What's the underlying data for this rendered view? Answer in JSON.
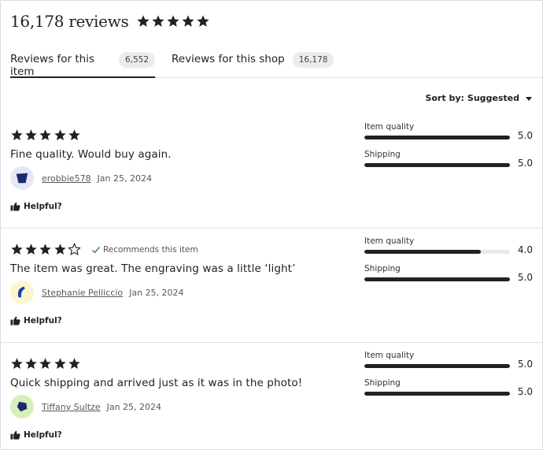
{
  "header": {
    "title": "16,178 reviews",
    "rating": 5
  },
  "tabs": [
    {
      "label": "Reviews for this item",
      "count": "6,552",
      "active": true
    },
    {
      "label": "Reviews for this shop",
      "count": "16,178",
      "active": false
    }
  ],
  "sort": {
    "label": "Sort by:",
    "value": "Suggested"
  },
  "colors": {
    "star": "#222222",
    "check": "#2e8a3a",
    "bar_fill": "#222222",
    "bar_track": "#e9e9e9"
  },
  "reviews": [
    {
      "stars": 5,
      "recommends": "",
      "text": "Fine quality. Would buy again.",
      "reviewer": "erobbie578",
      "date": "Jan 25, 2024",
      "avatar_bg": "#e6e6f5",
      "avatar_color": "#1a2a6c",
      "helpful_label": "Helpful?",
      "ratings": [
        {
          "label": "Item quality",
          "value": "5.0",
          "level": 1.0
        },
        {
          "label": "Shipping",
          "value": "5.0",
          "level": 1.0
        }
      ]
    },
    {
      "stars": 4,
      "recommends": "Recommends this item",
      "text": "The item was great. The engraving was a little ‘light’",
      "reviewer": "Stephanie Pelliccio",
      "date": "Jan 25, 2024",
      "avatar_bg": "#fbf6cf",
      "avatar_color": "#1c3fa8",
      "helpful_label": "Helpful?",
      "ratings": [
        {
          "label": "Item quality",
          "value": "4.0",
          "level": 0.8
        },
        {
          "label": "Shipping",
          "value": "5.0",
          "level": 1.0
        }
      ]
    },
    {
      "stars": 5,
      "recommends": "",
      "text": "Quick shipping and arrived just as it was in the photo!",
      "reviewer": "Tiffany Sultze",
      "date": "Jan 25, 2024",
      "avatar_bg": "#d8f0b8",
      "avatar_color": "#1a2a6c",
      "helpful_label": "Helpful?",
      "ratings": [
        {
          "label": "Item quality",
          "value": "5.0",
          "level": 1.0
        },
        {
          "label": "Shipping",
          "value": "5.0",
          "level": 1.0
        }
      ]
    }
  ]
}
